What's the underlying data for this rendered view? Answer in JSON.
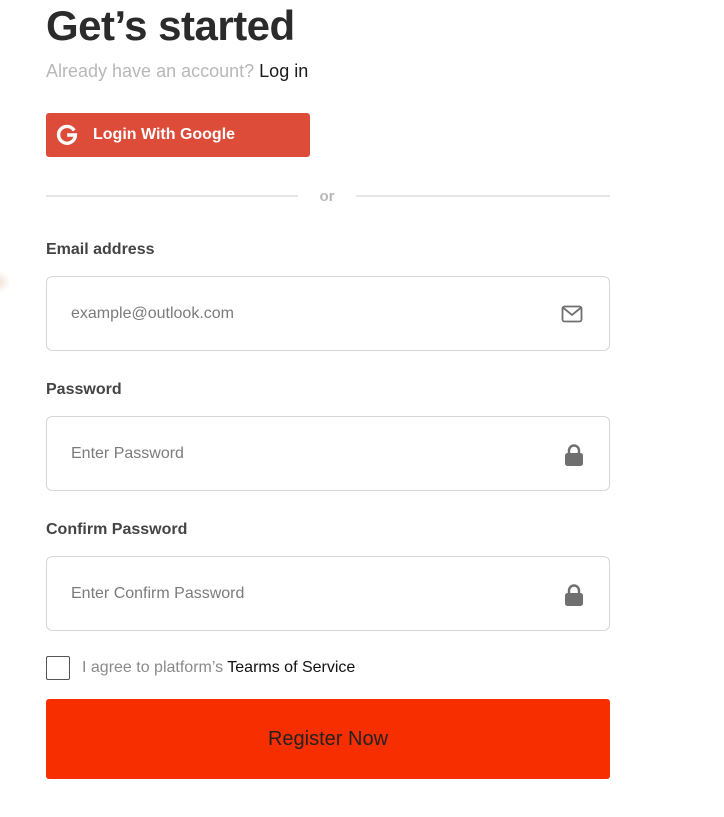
{
  "header": {
    "title": "Get’s started",
    "subtitle_prefix": "Already have an account?",
    "login_link": "Log in"
  },
  "google_button": {
    "label": "Login With Google",
    "icon": "google-g-icon",
    "color": "#dd4b39"
  },
  "divider": {
    "text": "or"
  },
  "form": {
    "email": {
      "label": "Email address",
      "placeholder": "example@outlook.com",
      "value": "",
      "icon": "mail-icon"
    },
    "password": {
      "label": "Password",
      "placeholder": "Enter Password",
      "value": "",
      "icon": "lock-icon"
    },
    "confirm_password": {
      "label": "Confirm Password",
      "placeholder": "Enter Confirm Password",
      "value": "",
      "icon": "lock-icon"
    },
    "terms": {
      "prefix": "I agree to platform’s",
      "link": "Tearms of Service",
      "checked": false
    },
    "submit": {
      "label": "Register Now",
      "color": "#f72f00"
    }
  }
}
